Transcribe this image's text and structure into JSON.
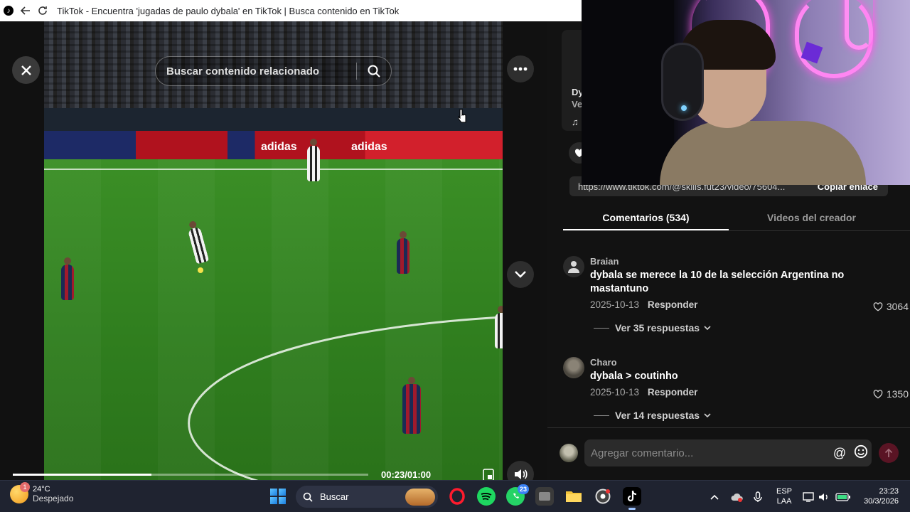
{
  "browser": {
    "title": "TikTok - Encuentra 'jugadas de paulo dybala' en TikTok | Busca contenido en TikTok"
  },
  "video": {
    "search_placeholder": "Buscar contenido relacionado",
    "time_display": "00:23/01:00",
    "progress_fraction": 0.39,
    "board_text_1": "adidas",
    "board_text_2": "adidas"
  },
  "creator": {
    "line1": "Dy",
    "line2": "Ve"
  },
  "share": {
    "url": "https://www.tiktok.com/@skills.fut23/video/75604...",
    "copy_label": "Copiar enlace"
  },
  "tabs": [
    {
      "label": "Comentarios (534)"
    },
    {
      "label": "Videos del creador"
    }
  ],
  "comments": [
    {
      "user": "Braian",
      "text": "dybala se merece la 10 de la selección Argentina no mastantuno",
      "date": "2025-10-13",
      "reply_label": "Responder",
      "likes": "3064",
      "replies_label": "Ver 35 respuestas"
    },
    {
      "user": "Charo",
      "text": "dybala > coutinho",
      "date": "2025-10-13",
      "reply_label": "Responder",
      "likes": "1350",
      "replies_label": "Ver 14 respuestas"
    }
  ],
  "comment_input": {
    "placeholder": "Agregar comentario..."
  },
  "taskbar": {
    "weather_temp": "24°C",
    "weather_cond": "Despejado",
    "weather_badge": "1",
    "search_label": "Buscar",
    "whatsapp_badge": "23",
    "lang_line1": "ESP",
    "lang_line2": "LAA",
    "time": "23:23",
    "date": "30/3/2026"
  },
  "colors": {
    "background": "#121212",
    "accent_send": "#fe2c55",
    "taskbar": "#1f2330"
  }
}
